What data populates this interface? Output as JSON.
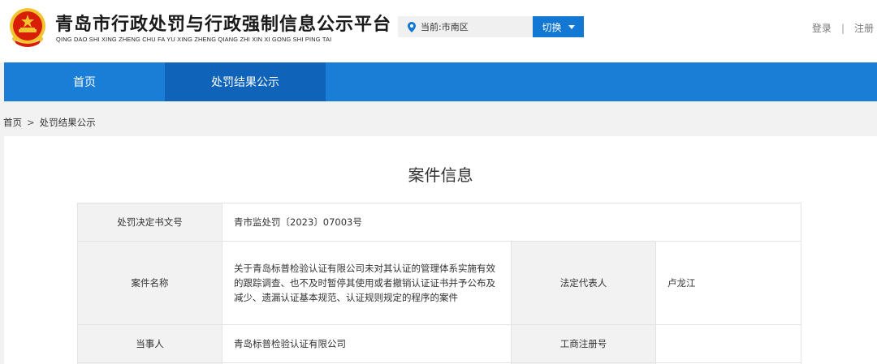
{
  "header": {
    "title": "青岛市行政处罚与行政强制信息公示平台",
    "subtitle": "QING DAO SHI XING ZHENG CHU FA YU XING ZHENG QIANG ZHI XIN XI GONG SHI PING TAI",
    "location_text": "当前:市南区",
    "switch_label": "切换",
    "login_label": "登录",
    "separator": "|",
    "register_label": "注册"
  },
  "nav": {
    "items": [
      {
        "label": "首页"
      },
      {
        "label": "处罚结果公示"
      }
    ]
  },
  "breadcrumb": {
    "home": "首页",
    "separator": ">",
    "current": "处罚结果公示"
  },
  "case": {
    "title": "案件信息",
    "rows": {
      "decision_no_label": "处罚决定书文号",
      "decision_no_value": "青市监处罚〔2023〕07003号",
      "case_name_label": "案件名称",
      "case_name_value": "关于青岛标普检验认证有限公司未对其认证的管理体系实施有效的跟踪调查、也不及时暂停其使用或者撤销认证证书并予公布及减少、遗漏认证基本规范、认证规则规定的程序的案件",
      "legal_rep_label": "法定代表人",
      "legal_rep_value": "卢龙江",
      "party_label": "当事人",
      "party_value": "青岛标普检验认证有限公司",
      "reg_no_label": "工商注册号",
      "reg_no_value": ""
    }
  },
  "colors": {
    "nav_bg": "#1a7ed6",
    "nav_active_bg": "#0f63b8",
    "switch_bg": "#1377d4",
    "emblem_red": "#d81e06",
    "emblem_gold": "#f4c430"
  }
}
